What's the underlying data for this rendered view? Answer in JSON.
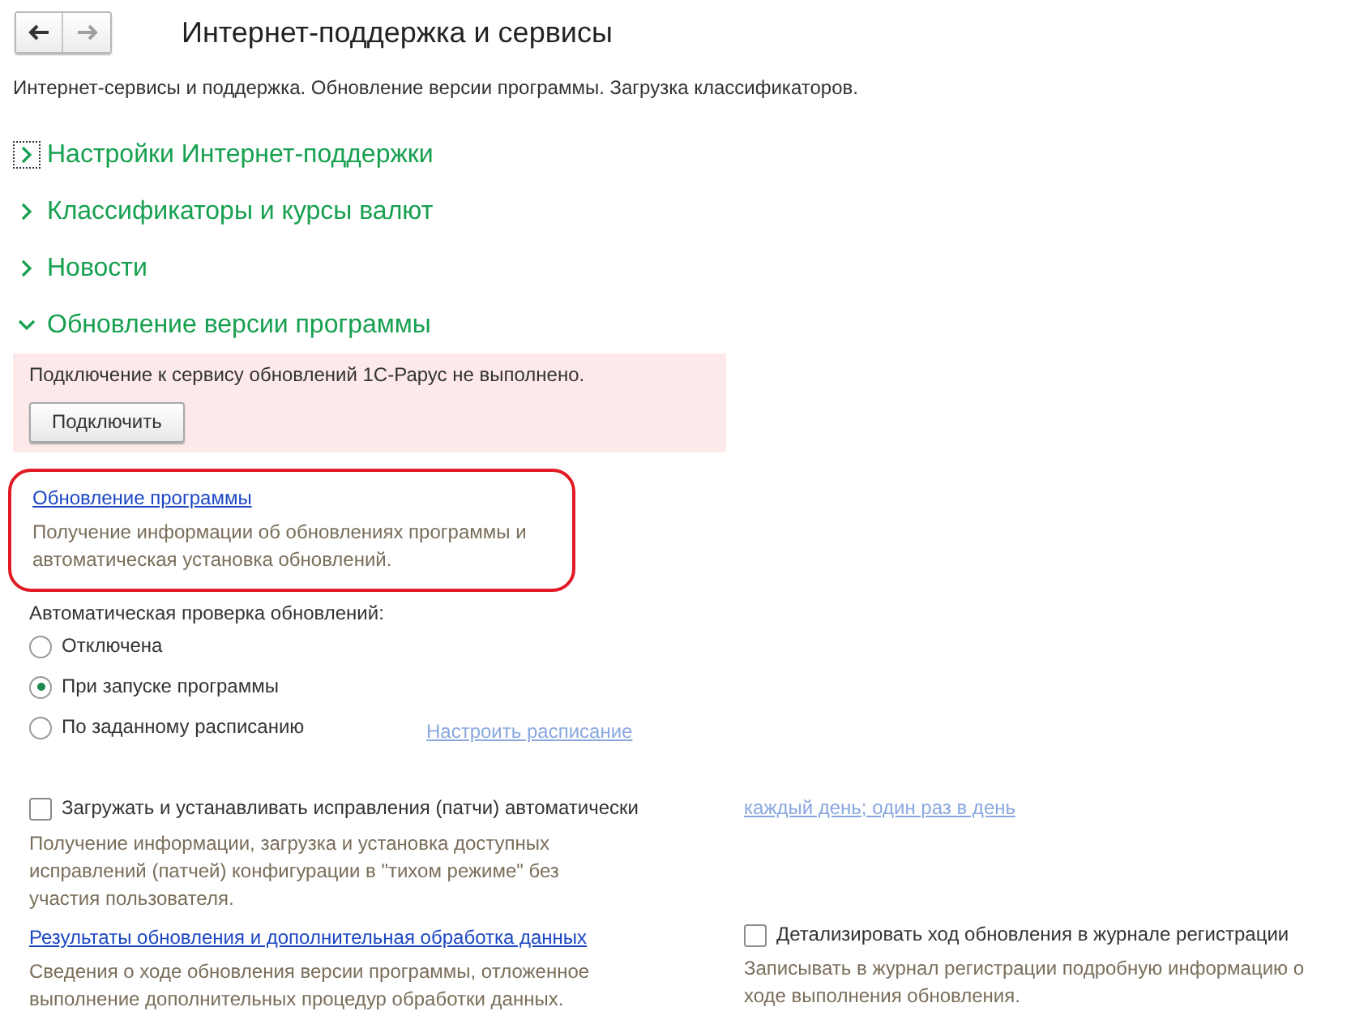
{
  "nav": {
    "back": {
      "disabled": false
    },
    "forward": {
      "disabled": true
    }
  },
  "title": "Интернет-поддержка и сервисы",
  "description": "Интернет-сервисы и поддержка. Обновление версии программы. Загрузка классификаторов.",
  "sections": [
    {
      "title": "Настройки Интернет-поддержки",
      "expanded": false,
      "focused": true
    },
    {
      "title": "Классификаторы и курсы валют",
      "expanded": false,
      "focused": false
    },
    {
      "title": "Новости",
      "expanded": false,
      "focused": false
    },
    {
      "title": "Обновление версии программы",
      "expanded": true,
      "focused": false
    }
  ],
  "alert": {
    "text": "Подключение к сервису обновлений 1С-Рарус не выполнено.",
    "button": "Подключить"
  },
  "update_link": {
    "label": "Обновление программы",
    "description": "Получение информации об обновлениях программы и автоматическая установка обновлений.",
    "highlighted": true
  },
  "auto_check": {
    "label": "Автоматическая проверка обновлений:",
    "options": [
      {
        "label": "Отключена",
        "selected": false
      },
      {
        "label": "При запуске программы",
        "selected": true
      },
      {
        "label": "По заданному расписанию",
        "selected": false
      }
    ],
    "schedule_link": {
      "label": "Настроить расписание",
      "disabled": true
    }
  },
  "patches": {
    "label": "Загружать и устанавливать исправления (патчи) автоматически",
    "checked": false,
    "description": "Получение информации, загрузка и установка доступных исправлений (патчей) конфигурации в \"тихом режиме\" без участия пользователя.",
    "schedule_link": {
      "label": "каждый день; один раз в день",
      "disabled": true
    }
  },
  "results": {
    "link": "Результаты обновления и дополнительная обработка данных",
    "description": "Сведения о ходе обновления версии программы, отложенное выполнение дополнительных процедур обработки данных."
  },
  "detail_log": {
    "label": "Детализировать ход обновления в журнале регистрации",
    "checked": false,
    "description": "Записывать в журнал регистрации подробную информацию о ходе выполнения обновления."
  }
}
